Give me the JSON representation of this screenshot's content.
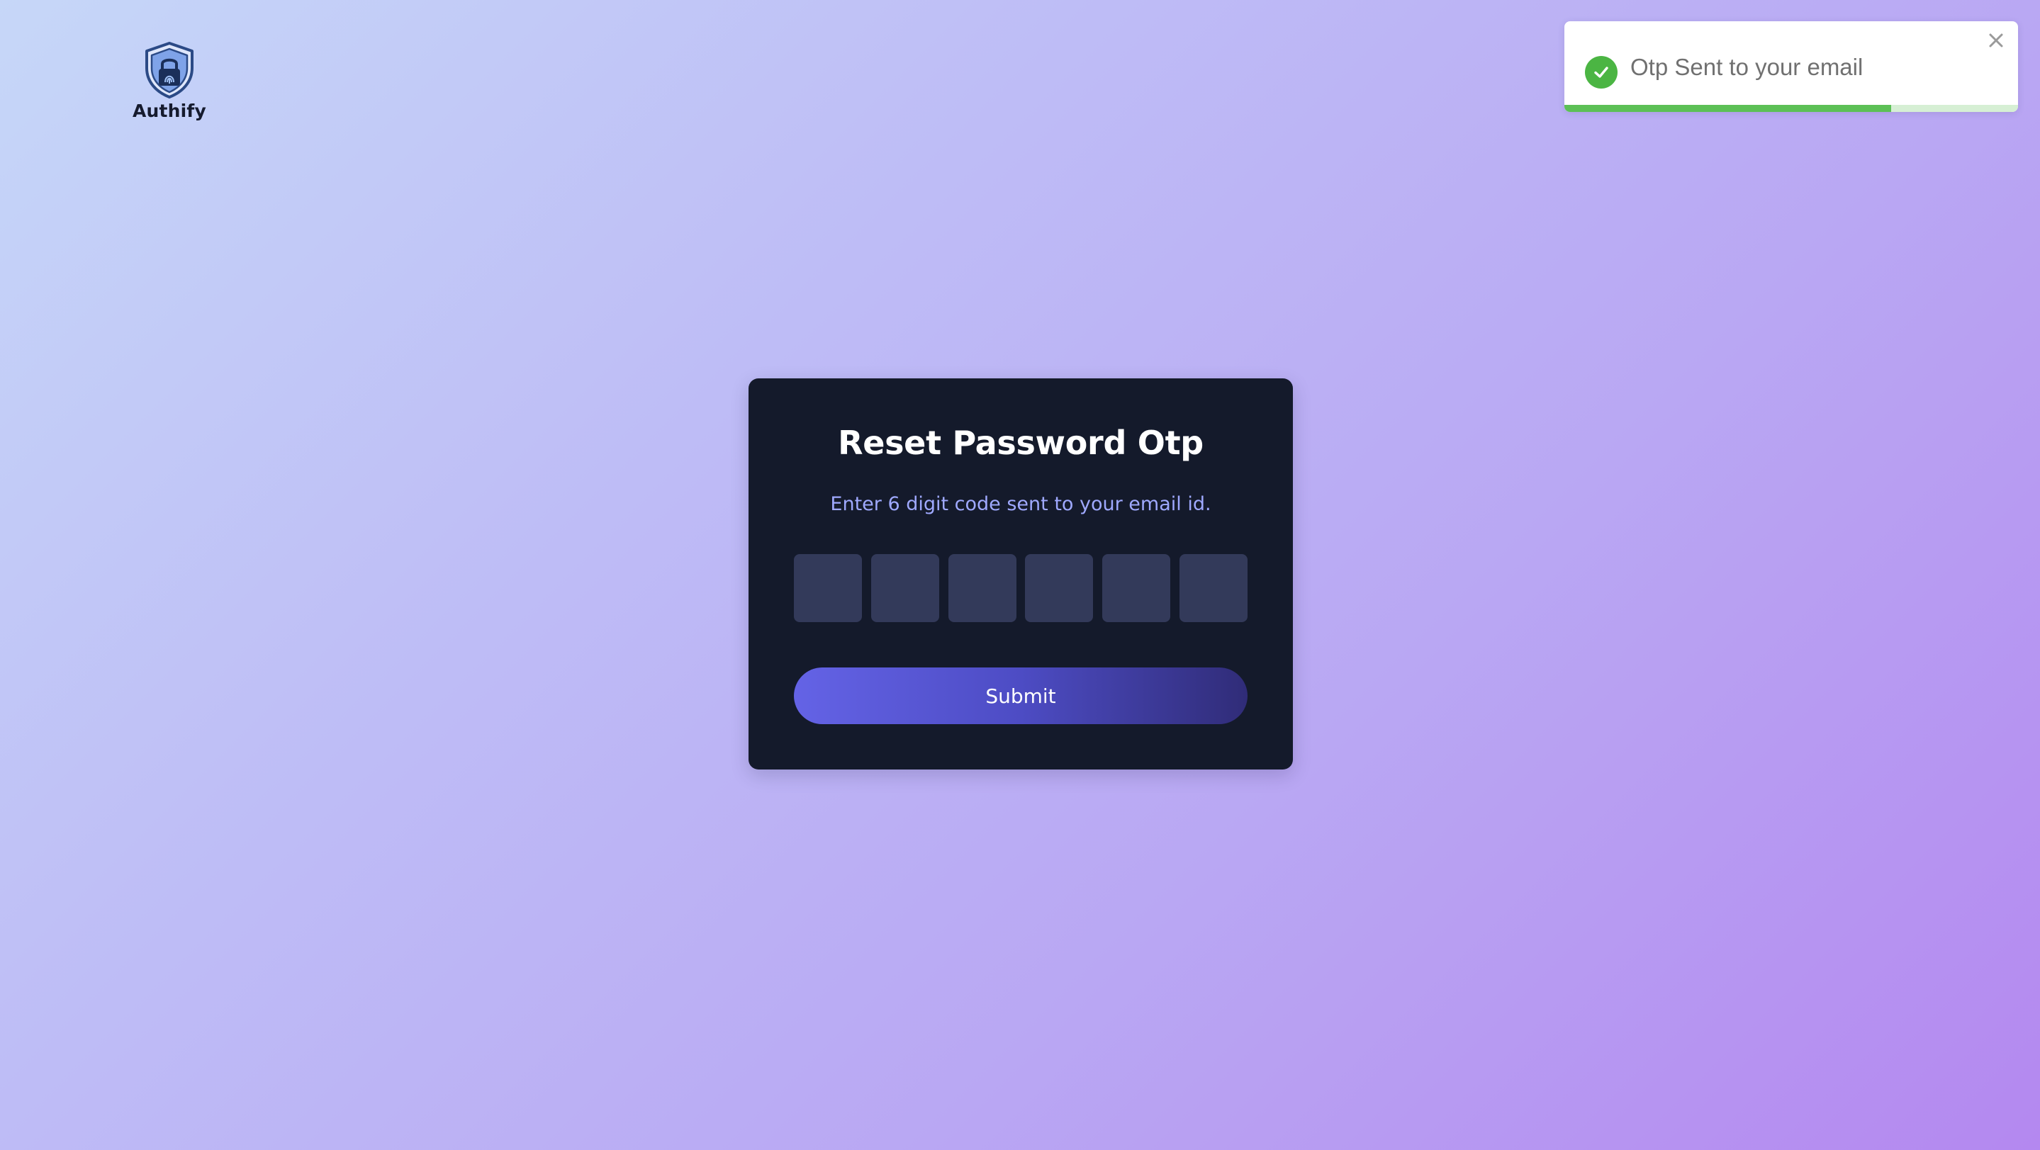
{
  "app": {
    "logo_text": "Authify"
  },
  "toast": {
    "message": "Otp Sent to your email",
    "icon": "check-circle-icon",
    "close_icon": "close-icon",
    "progress": 0.72,
    "success_color": "#4bb543"
  },
  "card": {
    "title": "Reset Password Otp",
    "subtitle": "Enter 6 digit code sent to your email id.",
    "otp_digits": [
      "",
      "",
      "",
      "",
      "",
      ""
    ],
    "submit_label": "Submit"
  },
  "colors": {
    "card_background": "#141a2b",
    "subtitle_color": "#9fa9ff",
    "otp_box": "#333a5a",
    "button_gradient_start": "#6463e6",
    "button_gradient_end": "#302c78"
  }
}
